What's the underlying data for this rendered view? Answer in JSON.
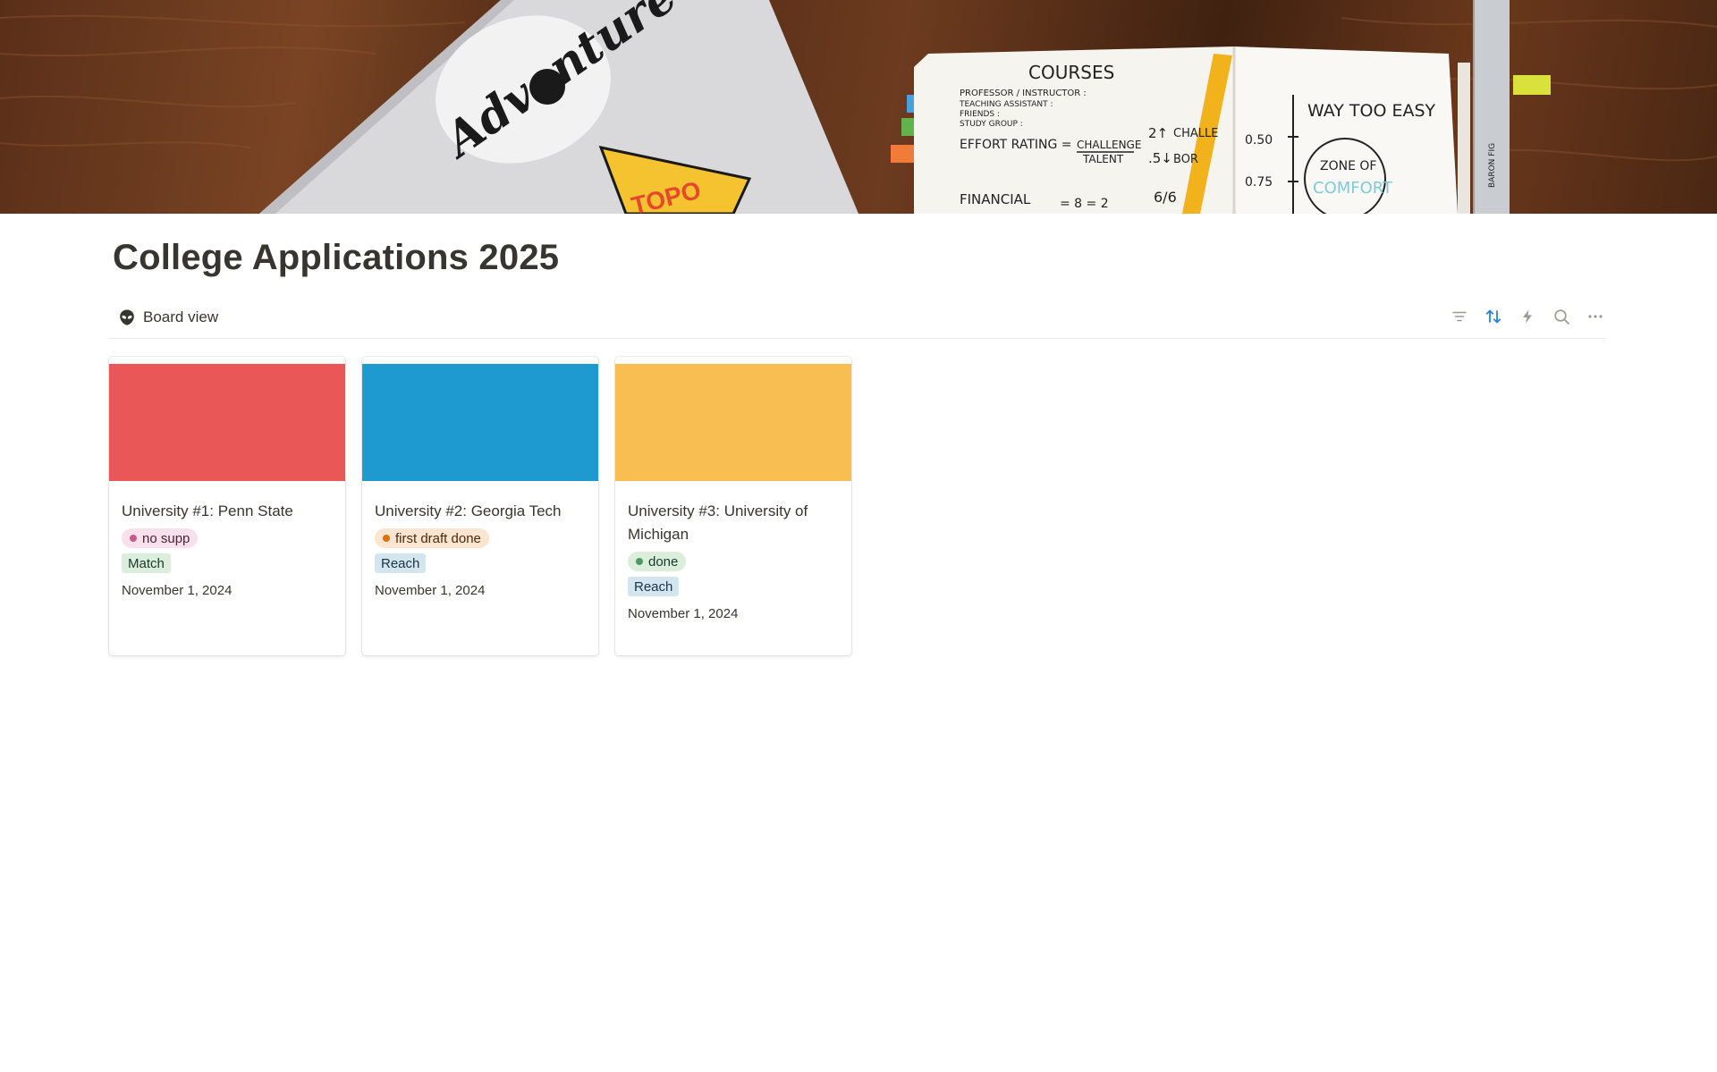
{
  "page": {
    "title": "College Applications 2025"
  },
  "view": {
    "label": "Board view",
    "icon": "alien-icon"
  },
  "toolbar": {
    "icons": [
      "filter-icon",
      "sort-icon",
      "lightning-icon",
      "search-icon",
      "more-icon"
    ],
    "accent_color": "#2383e2"
  },
  "cover": {
    "sticker_text": "Adventure TIL DEATH",
    "notebook_heading": "COURSES",
    "notebook_lines": [
      "PROFESSOR / INSTRUCTOR :",
      "TEACHING ASSISTANT :",
      "FRIENDS :",
      "STUDY GROUP :"
    ],
    "notebook_formula": "EFFORT RATING =",
    "notebook_fraction_top": "CHALLENGE",
    "notebook_fraction_bottom": "TALENT",
    "notebook_financial": "FINANCIAL",
    "notebook_right": "WAY TOO EASY",
    "notebook_values": [
      "0.50",
      "0.75"
    ],
    "notebook_circle_top": "ZONE OF",
    "notebook_circle_bottom": "COMFORT",
    "ruler_text": "BARON FIG",
    "pencil_text": "TOPO",
    "note_2a": "2↑",
    "note_2b": ".5↓",
    "note_chall": "CHALLE",
    "note_bor": "BOR",
    "note_eq": "= 8 = 2",
    "note_66": "6/6"
  },
  "cards": [
    {
      "title": "University #1: Penn State",
      "cover_color": "#e95757",
      "status": {
        "label": "no supp",
        "bg": "#f9e1ec",
        "dot": "#c65b8d",
        "text": "#4c2337"
      },
      "category": {
        "label": "Match",
        "bg": "#dbeddb",
        "text": "#1c3829"
      },
      "date": "November 1, 2024"
    },
    {
      "title": "University #2: Georgia Tech",
      "cover_color": "#1f9ad1",
      "status": {
        "label": "first draft done",
        "bg": "#fbe4d0",
        "dot": "#d9730d",
        "text": "#49290e"
      },
      "category": {
        "label": "Reach",
        "bg": "#d3e5ef",
        "text": "#183347"
      },
      "date": "November 1, 2024"
    },
    {
      "title": "University #3: University of Michigan",
      "cover_color": "#f8be52",
      "status": {
        "label": "done",
        "bg": "#dbeddb",
        "dot": "#4f9768",
        "text": "#1c3829"
      },
      "category": {
        "label": "Reach",
        "bg": "#d3e5ef",
        "text": "#183347"
      },
      "date": "November 1, 2024"
    }
  ]
}
